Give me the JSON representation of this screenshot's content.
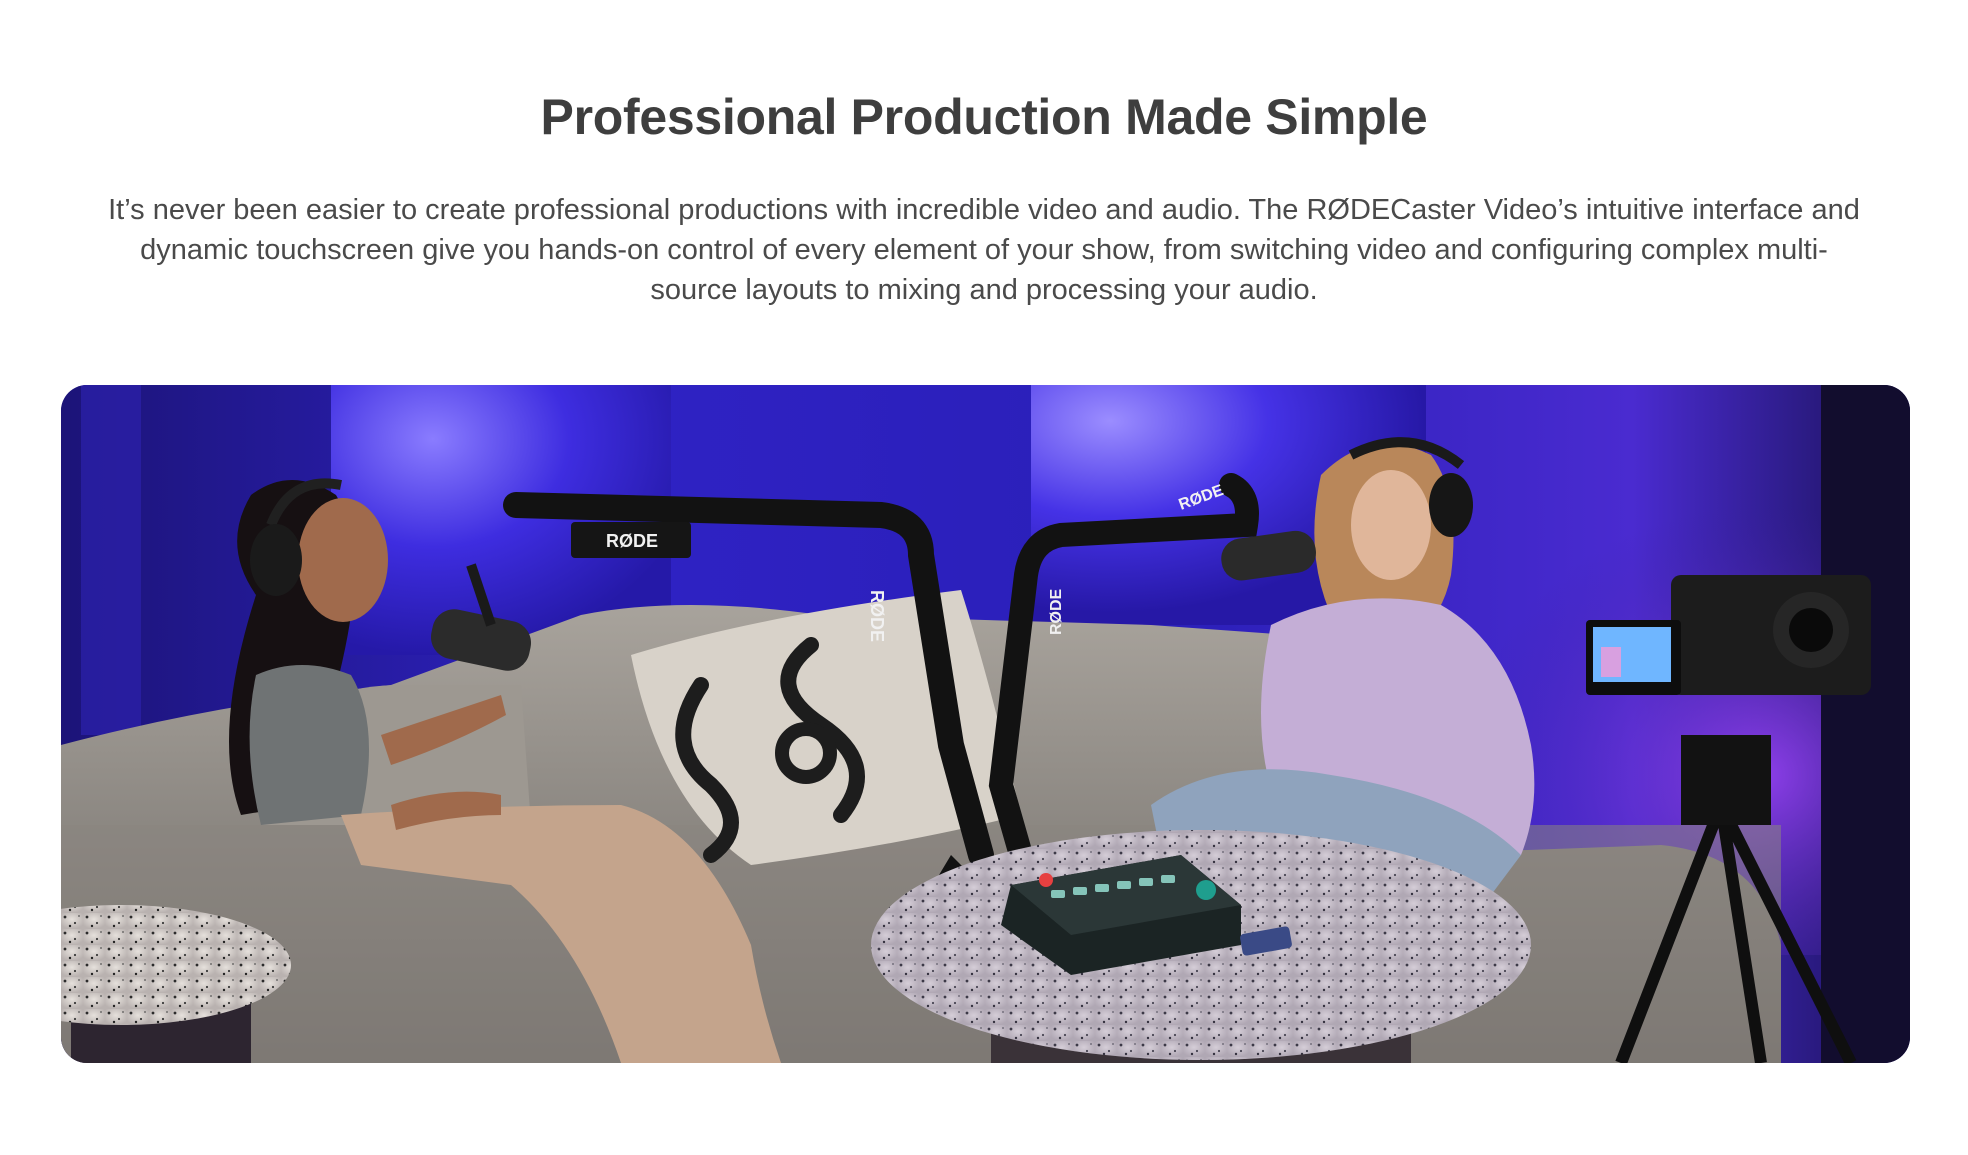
{
  "section": {
    "title": "Professional Production Made Simple",
    "description": "It’s never been easier to create professional productions with incredible video and audio. The RØDECaster Video’s intuitive interface and dynamic touchscreen give you hands-on control of every element of your show, from switching video and configuring complex multi-source layouts to mixing and processing your audio."
  },
  "hero": {
    "brand_marks": [
      "RØDE",
      "RØDE",
      "RØDE",
      "RØDE"
    ]
  },
  "colors": {
    "heading": "#3e3e3e",
    "body_text": "#4a4a4a",
    "studio_blue": "#3a25c8",
    "studio_purple": "#6a2fd6",
    "sofa_grey": "#9a9590",
    "table_terrazzo": "#d9d4d0"
  }
}
